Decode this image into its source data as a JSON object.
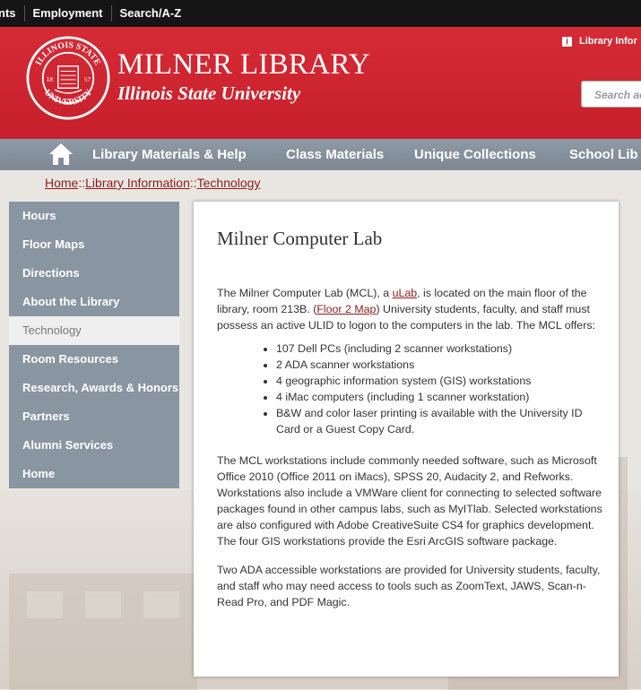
{
  "topbar": {
    "items": [
      "nts",
      "Employment",
      "Search/A-Z"
    ]
  },
  "header": {
    "title": "MILNER LIBRARY",
    "subtitle": "Illinois State University",
    "info_link": "Library Infor",
    "search_placeholder": "Search ac",
    "seal_text_top": "ILLINOIS STATE",
    "seal_text_bottom": "UNIVERSITY",
    "seal_year_left": "18",
    "seal_year_right": "57",
    "colors": {
      "red": "#c7202b",
      "nav": "#8995a1"
    }
  },
  "nav": {
    "items": [
      "Library Materials & Help",
      "Class Materials",
      "Unique Collections",
      "School Lib"
    ]
  },
  "breadcrumb": {
    "items": [
      "Home",
      "Library Information",
      "Technology"
    ],
    "separator": "::"
  },
  "sidebar": {
    "items": [
      {
        "label": "Hours"
      },
      {
        "label": "Floor Maps"
      },
      {
        "label": "Directions"
      },
      {
        "label": "About the Library"
      },
      {
        "label": "Technology"
      },
      {
        "label": "Room Resources"
      },
      {
        "label": "Research, Awards & Honors"
      },
      {
        "label": "Partners"
      },
      {
        "label": "Alumni Services"
      },
      {
        "label": "Home"
      }
    ],
    "active": "Technology"
  },
  "main": {
    "title": "Milner Computer Lab",
    "p1_a": "The Milner Computer Lab (MCL), a ",
    "p1_link1": "uLab",
    "p1_b": ", is located on the main floor of the library, room 213B. (",
    "p1_link2": "Floor 2 Map",
    "p1_c": ") University students, faculty, and staff must possess an active ULID to logon to the computers in the lab. The MCL offers:",
    "list": [
      "107 Dell PCs (including 2 scanner workstations)",
      "2 ADA scanner workstations",
      "4 geographic information system (GIS) workstations",
      "4 iMac computers (including 1 scanner workstation)",
      "B&W and color laser printing is available with the University ID Card or a Guest Copy Card."
    ],
    "p2": "The MCL workstations include commonly needed software, such as Microsoft Office 2010 (Office 2011 on iMacs), SPSS 20, Audacity 2, and Refworks. Workstations also include a VMWare client for connecting to selected software packages found in other campus labs, such as MyITlab. Selected workstations are also configured with Adobe CreativeSuite CS4 for graphics development. The four GIS workstations provide the Esri ArcGIS software package.",
    "p3": "Two ADA accessible workstations are provided for University students, faculty, and staff who may need access to tools such as ZoomText, JAWS, Scan-n-Read Pro, and PDF Magic."
  }
}
